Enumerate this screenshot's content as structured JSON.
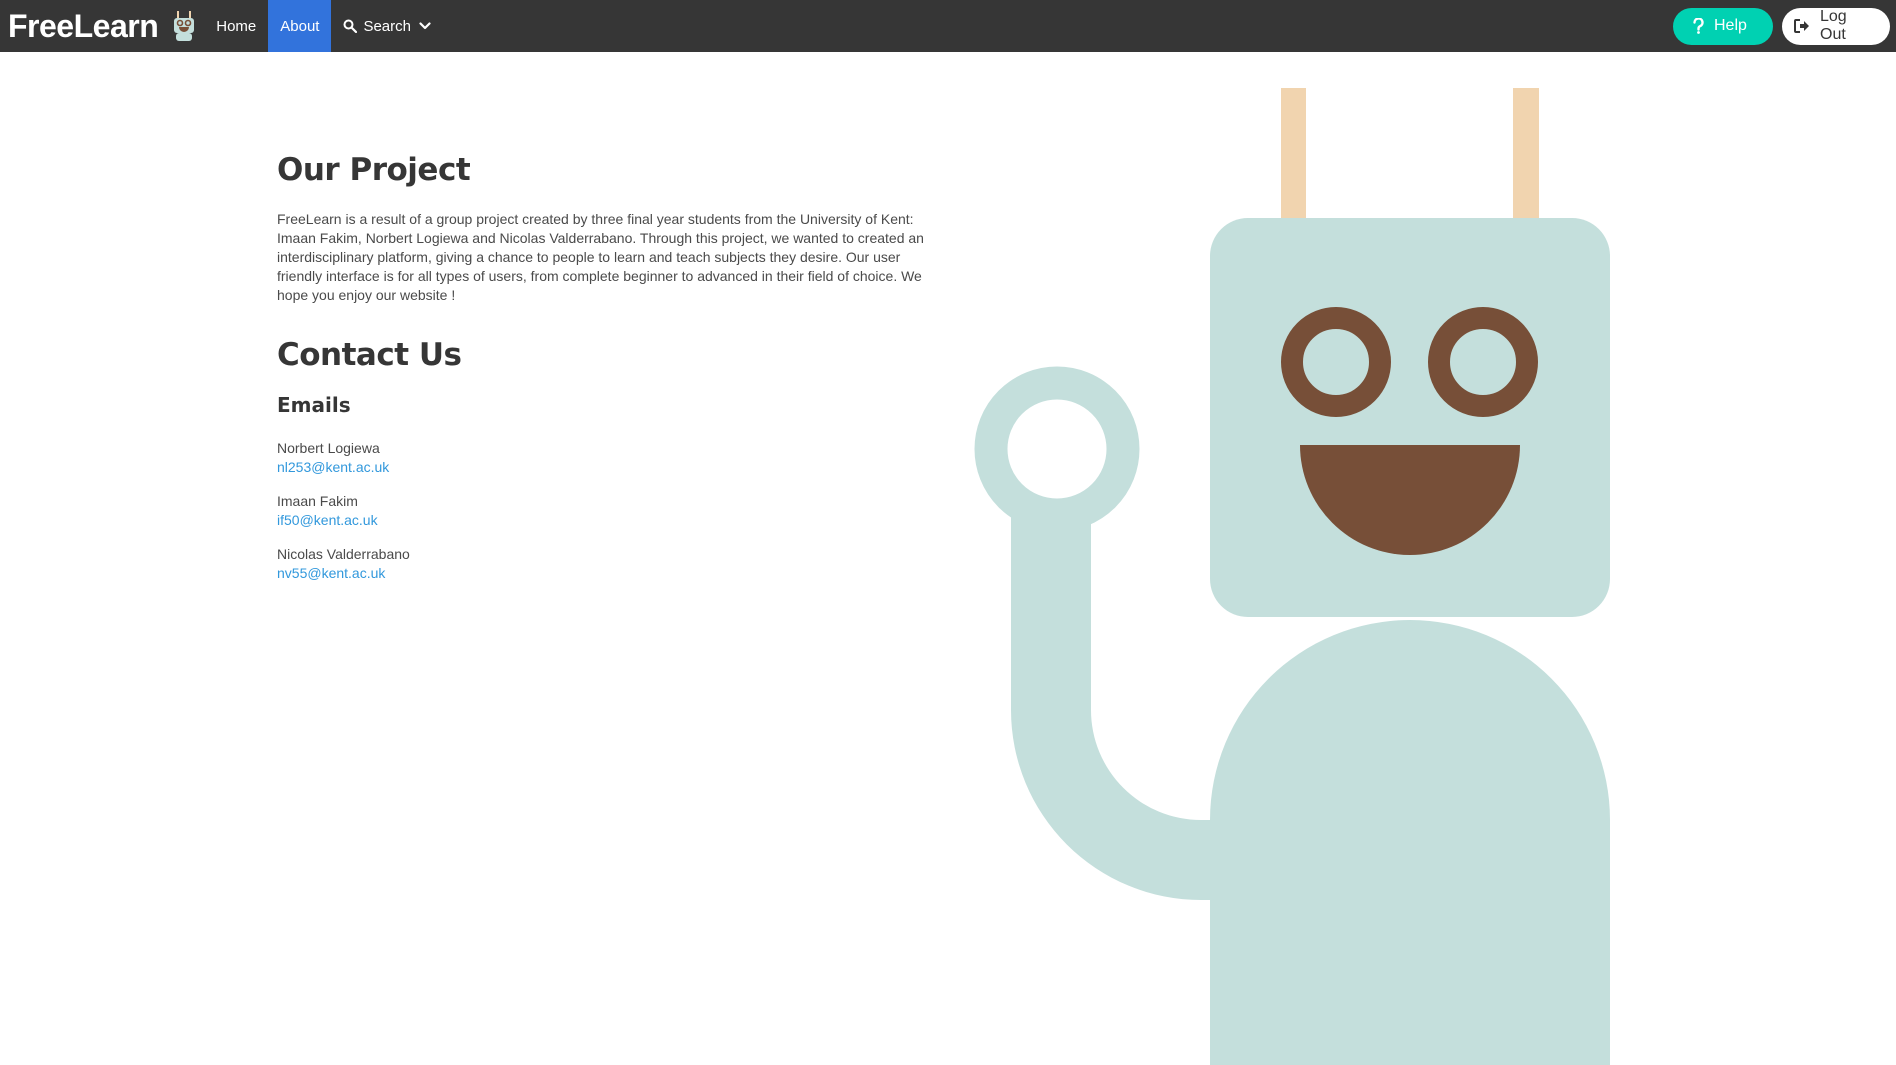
{
  "navbar": {
    "brand": "FreeLearn",
    "items": [
      {
        "label": "Home"
      },
      {
        "label": "About"
      },
      {
        "label": "Search"
      }
    ],
    "help_label": "Help",
    "logout_label": "Log Out"
  },
  "project": {
    "title": "Our Project",
    "text": "FreeLearn is a result of a group project created by three final year students from the University of Kent: Imaan Fakim, Norbert Logiewa and Nicolas Valderrabano. Through this project, we wanted to created an interdisciplinary platform, giving a chance to people to learn and teach subjects they desire. Our user friendly interface is for all types of users, from complete beginner to advanced in their field of choice. We hope you enjoy our website !"
  },
  "contact": {
    "title": "Contact Us",
    "emails_heading": "Emails",
    "people": [
      {
        "name": "Norbert Logiewa",
        "email": "nl253@kent.ac.uk"
      },
      {
        "name": "Imaan Fakim",
        "email": "if50@kent.ac.uk"
      },
      {
        "name": "Nicolas Valderrabano",
        "email": "nv55@kent.ac.uk"
      }
    ]
  },
  "colors": {
    "navbar": "#363636",
    "active_tab": "#3273dc",
    "help_button": "#00d1b2",
    "link": "#3298dc",
    "robot_body": "#c4dfdc",
    "robot_features": "#774f38",
    "robot_antenna": "#f1d4af"
  }
}
